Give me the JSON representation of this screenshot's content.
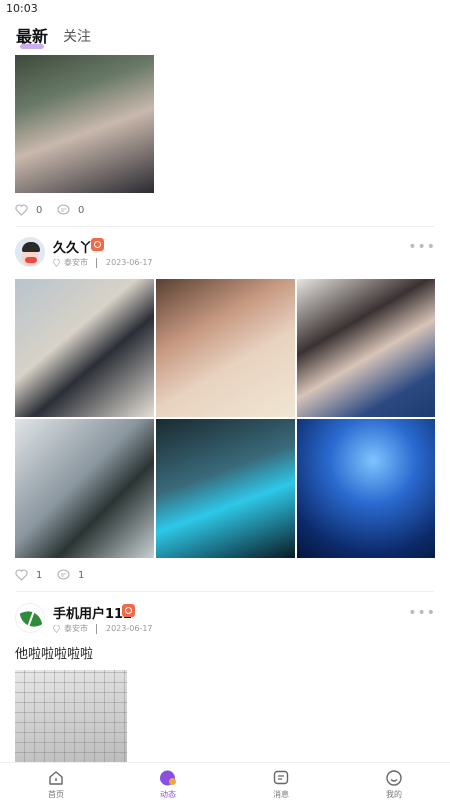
{
  "status": {
    "time": "10:03"
  },
  "tabs": {
    "latest": "最新",
    "following": "关注"
  },
  "posts": [
    {
      "likes": "0",
      "comments": "0"
    },
    {
      "username": "久久丫",
      "location": "泰安市",
      "date": "2023-06-17",
      "likes": "1",
      "comments": "1",
      "more": "•••"
    },
    {
      "username": "手机用户112",
      "location": "泰安市",
      "date": "2023-06-17",
      "text": "他啦啦啦啦啦",
      "more": "•••"
    }
  ],
  "nav": {
    "items": [
      {
        "label": "首页",
        "icon": "home-icon"
      },
      {
        "label": "动态",
        "icon": "moments-icon",
        "active": true
      },
      {
        "label": "消息",
        "icon": "message-icon"
      },
      {
        "label": "我的",
        "icon": "profile-icon"
      }
    ],
    "active_color": "#8a4fe0"
  },
  "colors": {
    "accent": "#b48cf0",
    "badge": "#f06a4a"
  }
}
